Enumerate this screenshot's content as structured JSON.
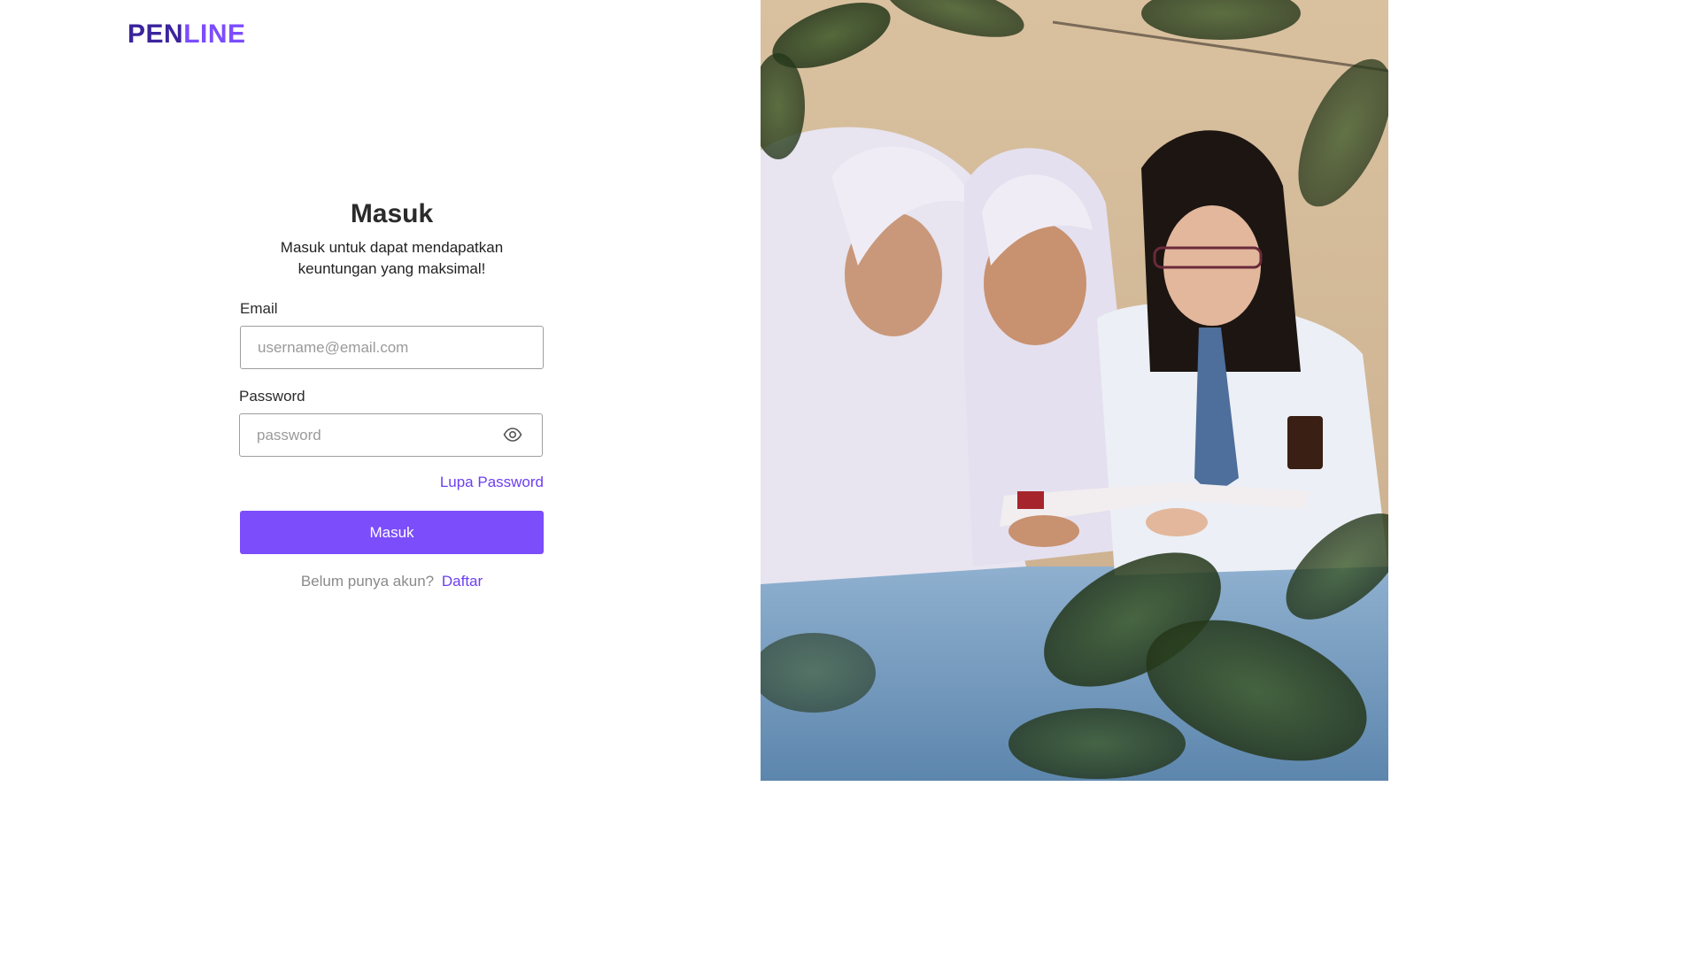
{
  "brand": {
    "part1": "PEN",
    "part2": "LINE",
    "color_primary": "#3b249c",
    "color_accent": "#7c4dff"
  },
  "login": {
    "title": "Masuk",
    "subtitle_line1": "Masuk untuk dapat mendapatkan",
    "subtitle_line2": "keuntungan yang maksimal!",
    "email_label": "Email",
    "email_placeholder": "username@email.com",
    "password_label": "Password",
    "password_placeholder": "password",
    "password_toggle_icon": "eye-icon",
    "forgot_link": "Lupa Password",
    "submit_label": "Masuk",
    "signup_prompt": "Belum punya akun?",
    "signup_link": "Daftar",
    "button_color": "#7b4dfb",
    "link_color": "#6d3ff0"
  },
  "hero_image": {
    "subject": "students-reading-photo"
  }
}
